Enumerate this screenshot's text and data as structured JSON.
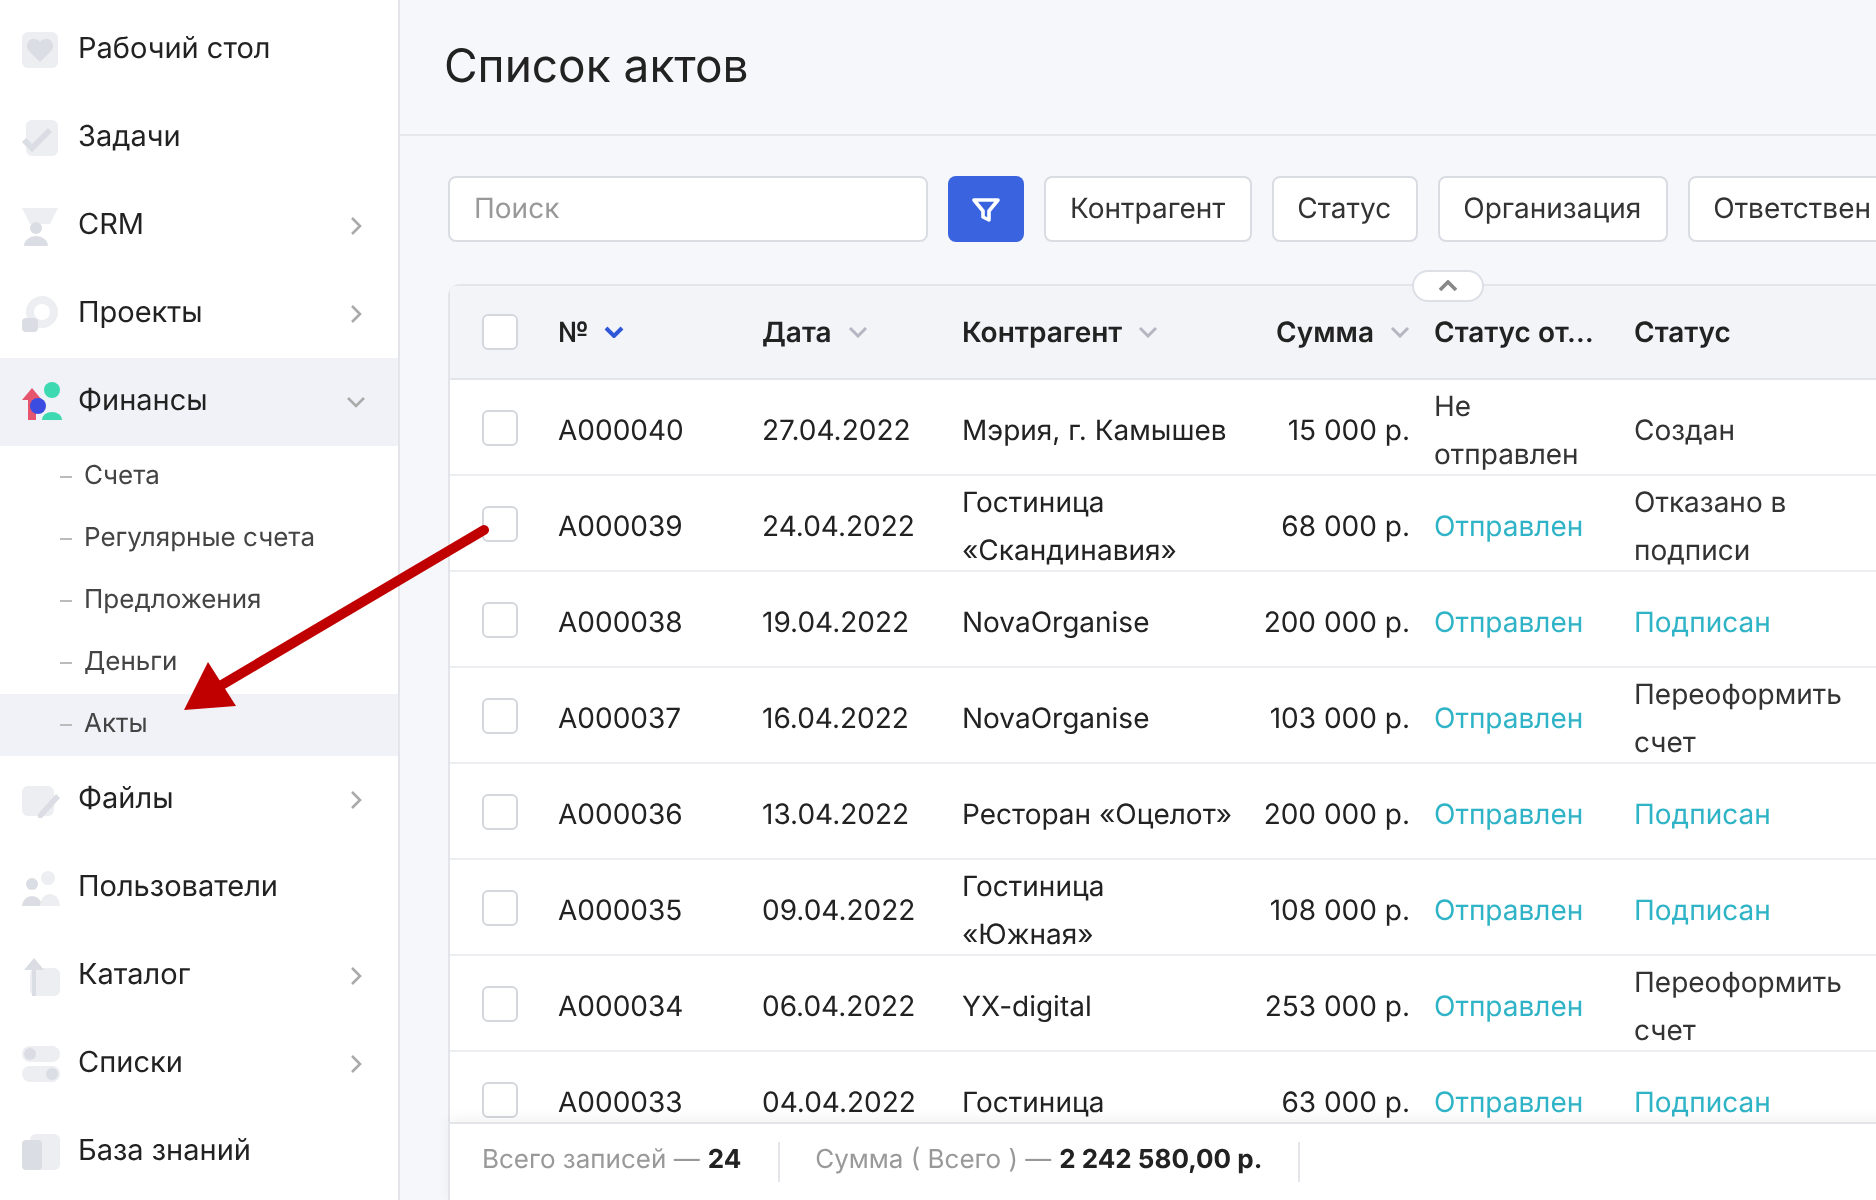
{
  "sidebar": {
    "items": [
      {
        "label": "Рабочий стол",
        "selected": false
      },
      {
        "label": "Задачи",
        "selected": false
      },
      {
        "label": "CRM",
        "expanded": false,
        "selected": false
      },
      {
        "label": "Проекты",
        "expanded": false,
        "selected": false
      },
      {
        "label": "Финансы",
        "expanded": true,
        "selected": true,
        "children": [
          {
            "label": "Счета",
            "selected": false
          },
          {
            "label": "Регулярные счета",
            "selected": false
          },
          {
            "label": "Предложения",
            "selected": false
          },
          {
            "label": "Деньги",
            "selected": false
          },
          {
            "label": "Акты",
            "selected": true
          }
        ]
      },
      {
        "label": "Файлы",
        "expanded": false,
        "selected": false
      },
      {
        "label": "Пользователи",
        "selected": false
      },
      {
        "label": "Каталог",
        "expanded": false,
        "selected": false
      },
      {
        "label": "Списки",
        "expanded": false,
        "selected": false
      },
      {
        "label": "База знаний",
        "selected": false
      }
    ]
  },
  "page_title": "Список актов",
  "search": {
    "placeholder": "Поиск"
  },
  "filters": [
    "Контрагент",
    "Статус",
    "Организация",
    "Ответствен"
  ],
  "table": {
    "collapse_toggle": {
      "expanded": true
    },
    "select_all": {
      "checked": false
    },
    "columns": [
      {
        "label": "№",
        "sort_active": true
      },
      {
        "label": "Дата",
        "sort_active": false
      },
      {
        "label": "Контрагент",
        "sort_active": false
      },
      {
        "label": "Сумма",
        "sort_active": false
      },
      {
        "label": "Статус от…"
      },
      {
        "label": "Статус"
      }
    ],
    "rows": [
      {
        "checked": false,
        "number": "A000040",
        "date": "27.04.2022",
        "counterparty": "Мэрия, г. Камышев",
        "sum": "15 000 р.",
        "send_status": {
          "text": "Не отправлен",
          "highlighted": false
        },
        "status": {
          "text": "Создан",
          "highlighted": false
        }
      },
      {
        "checked": false,
        "number": "A000039",
        "date": "24.04.2022",
        "counterparty": "Гостиница «Скандинавия»",
        "sum": "68 000 р.",
        "send_status": {
          "text": "Отправлен",
          "highlighted": true
        },
        "status": {
          "text": "Отказано в подписи",
          "highlighted": false
        }
      },
      {
        "checked": false,
        "number": "A000038",
        "date": "19.04.2022",
        "counterparty": "NovaOrganise",
        "sum": "200 000 р.",
        "send_status": {
          "text": "Отправлен",
          "highlighted": true
        },
        "status": {
          "text": "Подписан",
          "highlighted": true
        }
      },
      {
        "checked": false,
        "number": "A000037",
        "date": "16.04.2022",
        "counterparty": "NovaOrganise",
        "sum": "103 000 р.",
        "send_status": {
          "text": "Отправлен",
          "highlighted": true
        },
        "status": {
          "text": "Переоформить счет",
          "highlighted": false
        }
      },
      {
        "checked": false,
        "number": "A000036",
        "date": "13.04.2022",
        "counterparty": "Ресторан «Оцелот»",
        "sum": "200 000 р.",
        "send_status": {
          "text": "Отправлен",
          "highlighted": true
        },
        "status": {
          "text": "Подписан",
          "highlighted": true
        }
      },
      {
        "checked": false,
        "number": "A000035",
        "date": "09.04.2022",
        "counterparty": "Гостиница «Южная»",
        "sum": "108 000 р.",
        "send_status": {
          "text": "Отправлен",
          "highlighted": true
        },
        "status": {
          "text": "Подписан",
          "highlighted": true
        }
      },
      {
        "checked": false,
        "number": "A000034",
        "date": "06.04.2022",
        "counterparty": "YX-digital",
        "sum": "253 000 р.",
        "send_status": {
          "text": "Отправлен",
          "highlighted": true
        },
        "status": {
          "text": "Переоформить счет",
          "highlighted": false
        }
      },
      {
        "checked": false,
        "number": "A000033",
        "date": "04.04.2022",
        "counterparty": "Гостиница",
        "sum": "63 000 р.",
        "send_status": {
          "text": "Отправлен",
          "highlighted": true
        },
        "status": {
          "text": "Подписан",
          "highlighted": true
        }
      }
    ]
  },
  "footer": {
    "total_label": "Всего записей —",
    "total_value": "24",
    "sum_label": "Сумма ( Всего ) —",
    "sum_value": "2 242 580,00 р."
  }
}
